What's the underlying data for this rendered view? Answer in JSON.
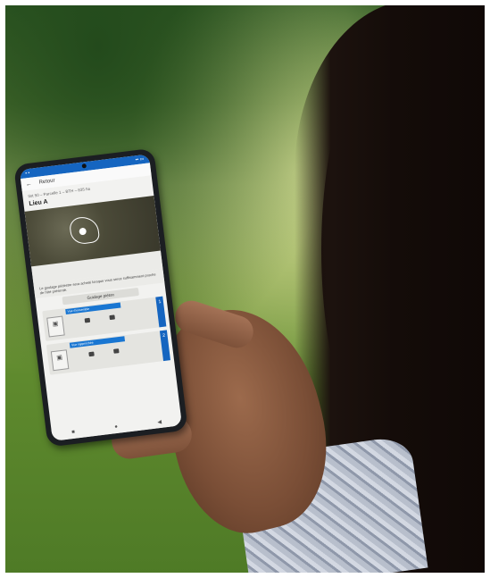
{
  "photo": {
    "subject": "",
    "phone_app": {
      "back_label": "Retour",
      "breadcrumb": "Ilot 50 – Parcelle 1 – BTH – 835 ha",
      "place_title": "Lieu A",
      "note_text": "Le goulage pédestre sera acheté lorsque vous serez suffisamment proche de l'été présenté.",
      "chip_label": "Guidage piéton",
      "cards": [
        {
          "title": "Vue d'ensemble",
          "tab": "1"
        },
        {
          "title": "Vue rapprochée",
          "tab": "2"
        }
      ],
      "nav_icons": [
        "square-icon",
        "circle-icon",
        "triangle-icon"
      ]
    }
  }
}
